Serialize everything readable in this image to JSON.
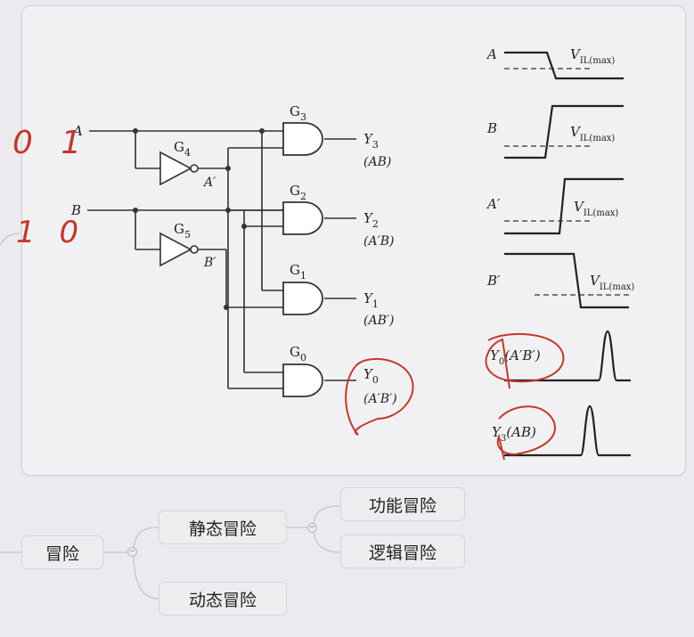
{
  "circuit": {
    "inputs": [
      {
        "label": "A",
        "handwritten": "0 1"
      },
      {
        "label": "B",
        "handwritten": "1 0"
      }
    ],
    "inverters": [
      {
        "name": "G",
        "sub": "4",
        "output": "A′"
      },
      {
        "name": "G",
        "sub": "5",
        "output": "B′"
      }
    ],
    "and_gates": [
      {
        "name": "G",
        "sub": "3",
        "out": "Y",
        "out_sub": "3",
        "expr": "(AB)"
      },
      {
        "name": "G",
        "sub": "2",
        "out": "Y",
        "out_sub": "2",
        "expr": "(A′B)"
      },
      {
        "name": "G",
        "sub": "1",
        "out": "Y",
        "out_sub": "1",
        "expr": "(AB′)"
      },
      {
        "name": "G",
        "sub": "0",
        "out": "Y",
        "out_sub": "0",
        "expr": "(A′B′)"
      }
    ]
  },
  "waveforms": [
    {
      "label": "A",
      "threshold": "V",
      "threshold_sub": "IL(max)"
    },
    {
      "label": "B",
      "threshold": "V",
      "threshold_sub": "IL(max)"
    },
    {
      "label": "A′",
      "threshold": "V",
      "threshold_sub": "IL(max)"
    },
    {
      "label": "B′",
      "threshold": "V",
      "threshold_sub": "IL(max)"
    },
    {
      "label": "Y",
      "sub": "0",
      "expr": "(A′B′)"
    },
    {
      "label": "Y",
      "sub": "3",
      "expr": "(AB)"
    }
  ],
  "mindmap": {
    "root": "冒险",
    "static": "静态冒险",
    "dynamic": "动态冒险",
    "functional": "功能冒险",
    "logic": "逻辑冒险",
    "toggle_symbol": "−"
  }
}
